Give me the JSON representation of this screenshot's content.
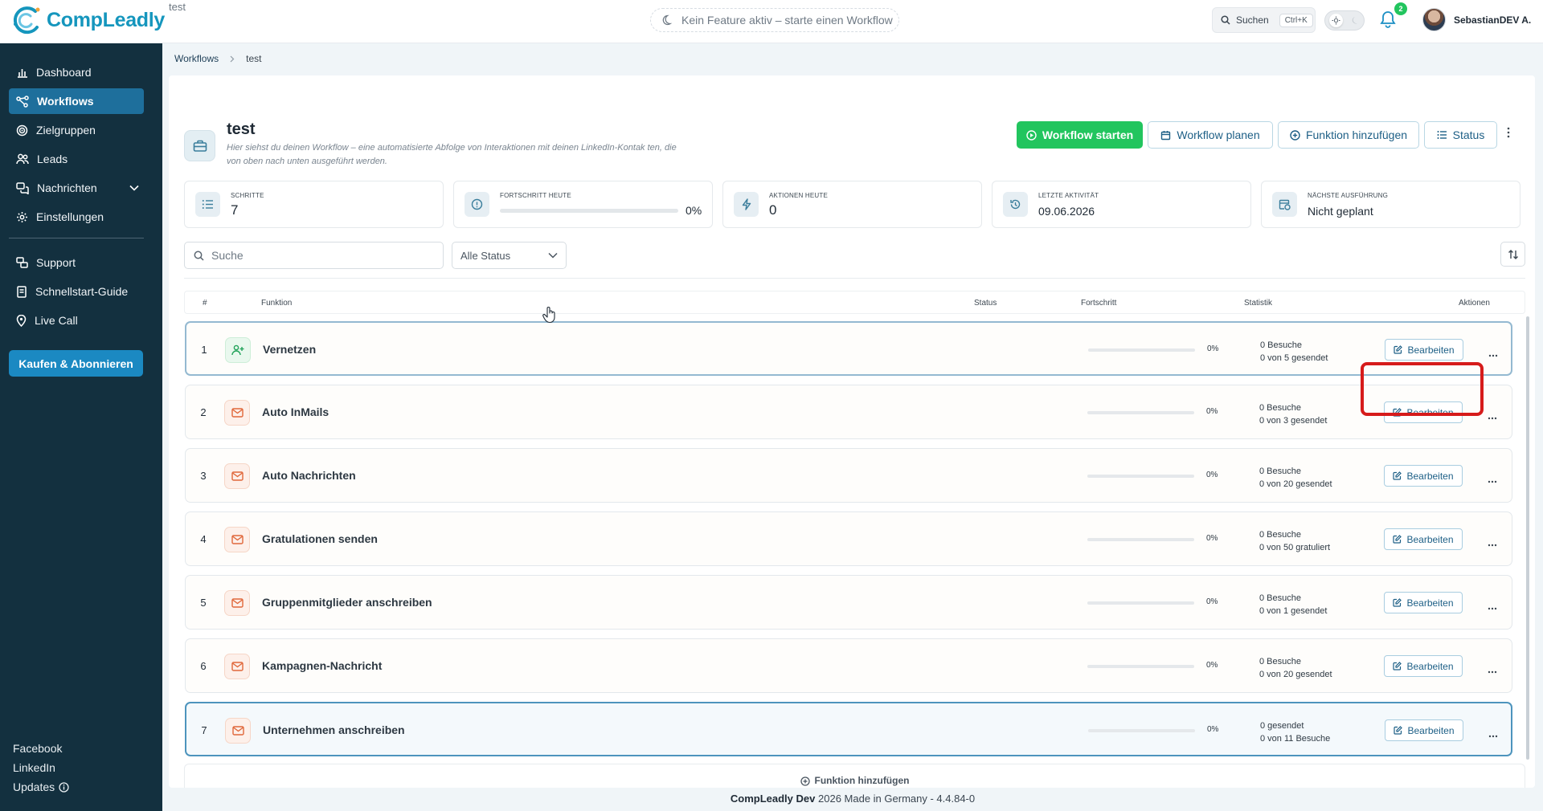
{
  "app": {
    "logo_text": "CompLeadly",
    "window_title": "test",
    "feature_status": "Kein Feature aktiv – starte einen Workflow",
    "search_label": "Suchen",
    "search_shortcut": "Ctrl+K",
    "notification_count": "2",
    "user_name": "SebastianDEV A."
  },
  "sidebar": {
    "items": [
      {
        "label": "Dashboard",
        "icon": "bar-chart-icon"
      },
      {
        "label": "Workflows",
        "icon": "workflow-icon",
        "active": true
      },
      {
        "label": "Zielgruppen",
        "icon": "target-icon"
      },
      {
        "label": "Leads",
        "icon": "users-icon"
      },
      {
        "label": "Nachrichten",
        "icon": "messages-icon"
      },
      {
        "label": "Einstellungen",
        "icon": "gear-icon"
      }
    ],
    "secondary": [
      {
        "label": "Support",
        "icon": "support-icon"
      },
      {
        "label": "Schnellstart-Guide",
        "icon": "book-icon"
      },
      {
        "label": "Live Call",
        "icon": "location-icon"
      }
    ],
    "buy_label": "Kaufen & Abonnieren",
    "links": {
      "facebook": "Facebook",
      "linkedin": "LinkedIn",
      "updates": "Updates"
    }
  },
  "breadcrumb": {
    "root": "Workflows",
    "current": "test"
  },
  "workflow": {
    "title": "test",
    "description": "Hier siehst du deinen Workflow – eine automatisierte Abfolge von Interaktionen mit deinen LinkedIn-Kontak ten, die von oben nach unten ausgeführt werden.",
    "buttons": {
      "start": "Workflow starten",
      "plan": "Workflow planen",
      "add_function": "Funktion hinzufügen",
      "status": "Status"
    }
  },
  "stats": {
    "steps": {
      "label": "SCHRITTE",
      "value": "7"
    },
    "progress_today": {
      "label": "FORTSCHRITT HEUTE",
      "value": "0%",
      "fraction": 0
    },
    "actions_today": {
      "label": "AKTIONEN HEUTE",
      "value": "0"
    },
    "last_activity": {
      "label": "LETZTE AKTIVITÄT",
      "value": "09.06.2026"
    },
    "next_run": {
      "label": "NÄCHSTE AUSFÜHRUNG",
      "value": "Nicht geplant"
    }
  },
  "filters": {
    "search_placeholder": "Suche",
    "status_value": "Alle Status"
  },
  "table": {
    "headers": {
      "num": "#",
      "function": "Funktion",
      "status": "Status",
      "progress": "Fortschritt",
      "stats": "Statistik",
      "actions": "Aktionen"
    },
    "edit_label": "Bearbeiten",
    "rows": [
      {
        "num": "1",
        "name": "Vernetzen",
        "icon": "user-plus-icon",
        "progress": "0%",
        "stat1": "0 Besuche",
        "stat2": "0 von 5 gesendet"
      },
      {
        "num": "2",
        "name": "Auto InMails",
        "icon": "mail-icon",
        "progress": "0%",
        "stat1": "0 Besuche",
        "stat2": "0 von 3 gesendet"
      },
      {
        "num": "3",
        "name": "Auto Nachrichten",
        "icon": "mail-icon",
        "progress": "0%",
        "stat1": "0 Besuche",
        "stat2": "0 von 20 gesendet"
      },
      {
        "num": "4",
        "name": "Gratulationen senden",
        "icon": "mail-icon",
        "progress": "0%",
        "stat1": "0 Besuche",
        "stat2": "0 von 50 gratuliert"
      },
      {
        "num": "5",
        "name": "Gruppenmitglieder anschreiben",
        "icon": "mail-icon",
        "progress": "0%",
        "stat1": "0 Besuche",
        "stat2": "0 von 1 gesendet"
      },
      {
        "num": "6",
        "name": "Kampagnen-Nachricht",
        "icon": "mail-icon",
        "progress": "0%",
        "stat1": "0 Besuche",
        "stat2": "0 von 20 gesendet"
      },
      {
        "num": "7",
        "name": "Unternehmen anschreiben",
        "icon": "mail-icon",
        "progress": "0%",
        "stat1": "0 gesendet",
        "stat2": "0 von 11 Besuche"
      }
    ],
    "add_function_label": "Funktion hinzufügen"
  },
  "footer": {
    "brand": "CompLeadly Dev",
    "text": "2026 Made in Germany - 4.4.84-0"
  },
  "colors": {
    "sidebar_bg": "#13303f",
    "active_nav": "#1e6f9c",
    "primary_green": "#22c55e",
    "accent_blue": "#1b89c2",
    "highlight_red": "#d61b1b"
  }
}
